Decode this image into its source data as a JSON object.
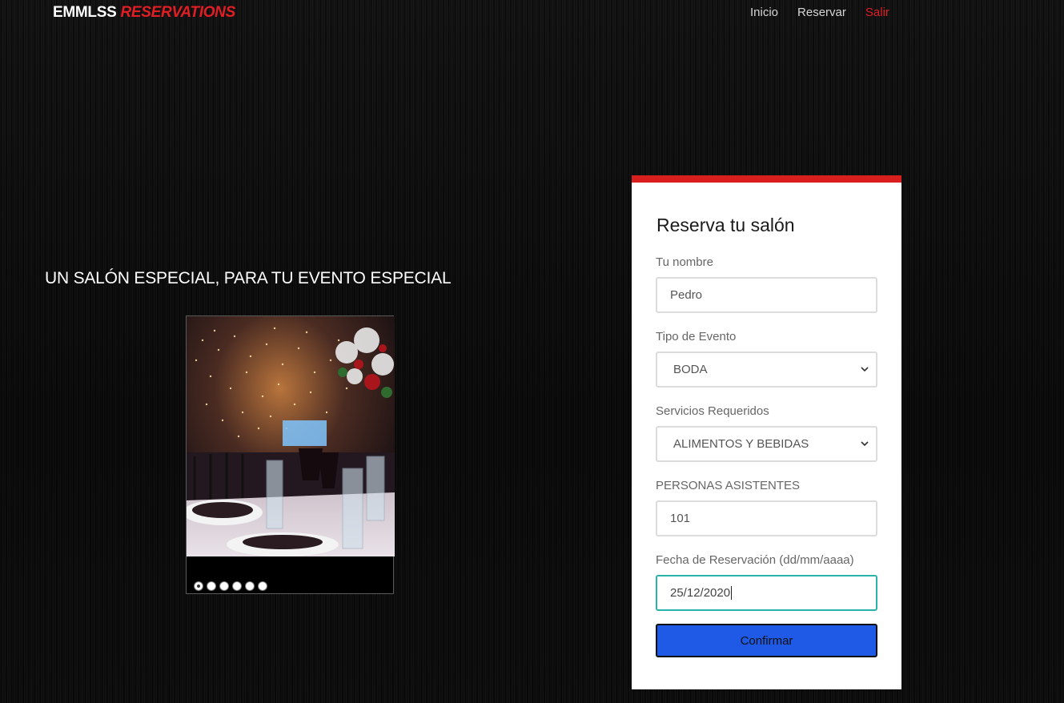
{
  "nav": {
    "brand_main": "EMMLSS",
    "brand_accent": "RESERVATIONS",
    "links": [
      "Inicio",
      "Reservar",
      "Salir"
    ]
  },
  "hero": {
    "tagline": "UN SALÓN ESPECIAL, PARA TU EVENTO ESPECIAL"
  },
  "slider": {
    "dot_count": 6,
    "active_index": 0
  },
  "form": {
    "title": "Reserva tu salón",
    "name_label": "Tu nombre",
    "name_value": "Pedro",
    "event_label": "Tipo de Evento",
    "event_value": "BODA",
    "services_label": "Servicios Requeridos",
    "services_value": "ALIMENTOS Y BEBIDAS",
    "guests_label": "PERSONAS ASISTENTES",
    "guests_value": "101",
    "date_label": "Fecha de Reservación (dd/mm/aaaa)",
    "date_value": "25/12/2020",
    "confirm_label": "Confirmar"
  },
  "colors": {
    "accent_red": "#e01e24",
    "focus_teal": "#2ab3a8",
    "button_blue": "#1f5ae6"
  }
}
